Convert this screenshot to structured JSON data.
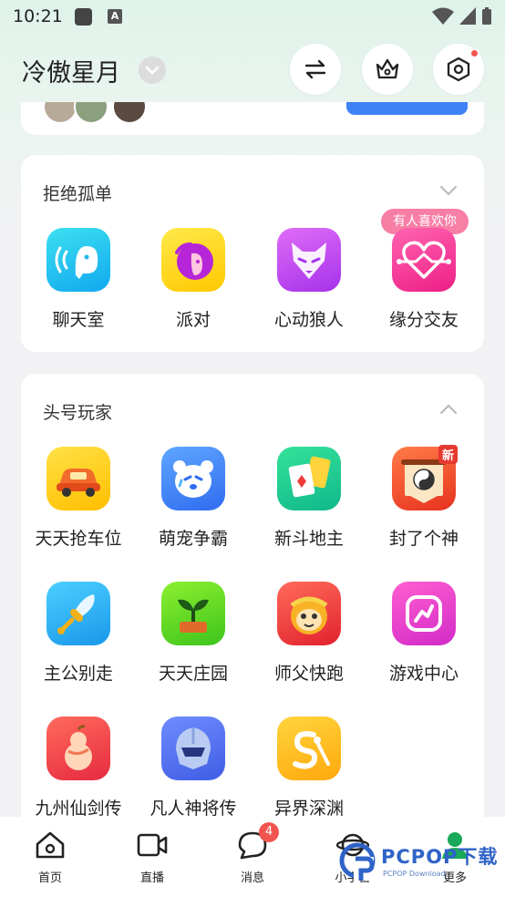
{
  "status_bar": {
    "time": "10:21",
    "notif_letter": "A"
  },
  "header": {
    "username": "冷傲星月"
  },
  "section_1": {
    "title": "拒绝孤单",
    "hint": "有人喜欢你",
    "items": [
      {
        "label": "聊天室",
        "icon": "chat-room-icon"
      },
      {
        "label": "派对",
        "icon": "party-icon"
      },
      {
        "label": "心动狼人",
        "icon": "werewolf-icon"
      },
      {
        "label": "缘分交友",
        "icon": "heart-match-icon"
      }
    ]
  },
  "section_2": {
    "title": "头号玩家",
    "new_badge": "新",
    "items": [
      {
        "label": "天天抢车位",
        "icon": "car-icon"
      },
      {
        "label": "萌宠争霸",
        "icon": "bear-icon"
      },
      {
        "label": "新斗地主",
        "icon": "cards-icon"
      },
      {
        "label": "封了个神",
        "icon": "taiji-icon"
      },
      {
        "label": "主公别走",
        "icon": "sword-icon"
      },
      {
        "label": "天天庄园",
        "icon": "sprout-icon"
      },
      {
        "label": "师父快跑",
        "icon": "monkey-icon"
      },
      {
        "label": "游戏中心",
        "icon": "game-center-icon"
      },
      {
        "label": "九州仙剑传",
        "icon": "gourd-icon"
      },
      {
        "label": "凡人神将传",
        "icon": "helmet-icon"
      },
      {
        "label": "异界深渊",
        "icon": "abyss-icon"
      }
    ]
  },
  "bottom_nav": {
    "items": [
      {
        "label": "首页",
        "icon": "home-icon"
      },
      {
        "label": "直播",
        "icon": "video-icon"
      },
      {
        "label": "消息",
        "icon": "message-icon",
        "badge": "4"
      },
      {
        "label": "小宇宙",
        "icon": "planet-icon"
      },
      {
        "label": "更多",
        "icon": "person-icon"
      }
    ]
  },
  "watermark": {
    "text": "PCPOP下载",
    "sub": "PCPOP Download"
  },
  "colors": {
    "accent_blue": "#3f82f7",
    "badge_red": "#f2554f",
    "hint_pink": "#f77fa5"
  }
}
